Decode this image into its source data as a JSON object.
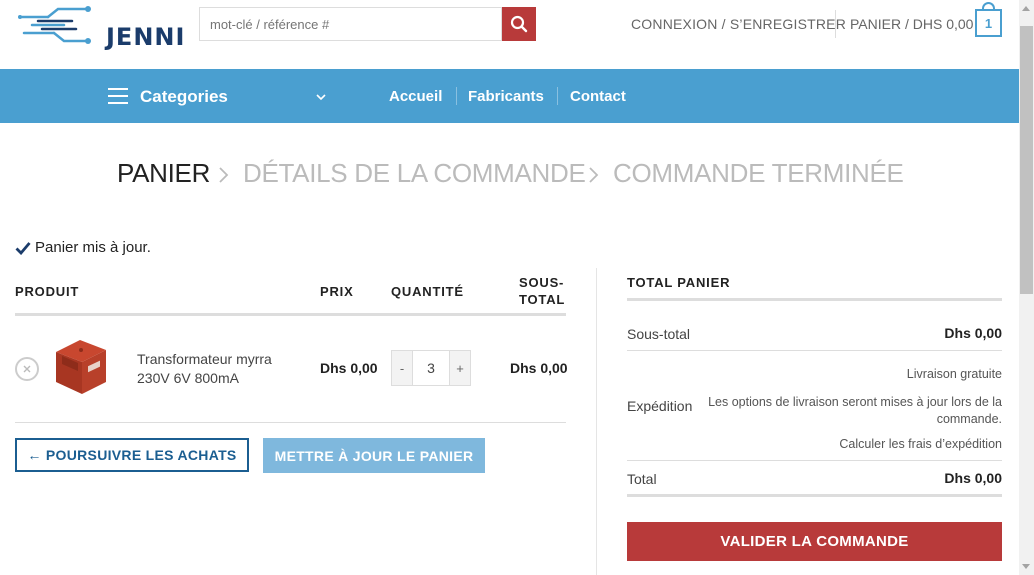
{
  "header": {
    "logo_text": "JENNI",
    "search_placeholder": "mot-clé / référence #",
    "login_label": "CONNEXION / S’ENREGISTRER",
    "cart_label": "PANIER / DHS 0,00",
    "cart_count": "1"
  },
  "nav": {
    "categories_label": "Categories",
    "links": [
      "Accueil",
      "Fabricants",
      "Contact"
    ]
  },
  "steps": {
    "step1": "PANIER",
    "step2": "DÉTAILS DE LA COMMANDE",
    "step3": "COMMANDE TERMINÉE"
  },
  "notice": "Panier mis à jour.",
  "cart_table": {
    "headers": {
      "product": "PRODUIT",
      "price": "PRIX",
      "quantity": "QUANTITÉ",
      "subtotal_line1": "SOUS-",
      "subtotal_line2": "TOTAL"
    },
    "items": [
      {
        "name_line1": "Transformateur myrra",
        "name_line2": "230V 6V 800mA",
        "price": "Dhs 0,00",
        "quantity": "3",
        "subtotal": "Dhs 0,00"
      }
    ],
    "qty_minus": "-",
    "qty_plus": "+",
    "continue_label": "← POURSUIVRE LES ACHATS",
    "update_label": "METTRE À JOUR LE PANIER"
  },
  "totals": {
    "title": "TOTAL PANIER",
    "subtotal_label": "Sous-total",
    "subtotal_value": "Dhs 0,00",
    "shipping_label": "Expédition",
    "shipping_free": "Livraison gratuite",
    "shipping_note_line1": "Les options de livraison seront mises à jour lors de la",
    "shipping_note_line2": "commande.",
    "shipping_calc": "Calculer les frais d’expédition",
    "total_label": "Total",
    "total_value": "Dhs 0,00",
    "checkout_label": "VALIDER LA COMMANDE"
  },
  "colors": {
    "brand_blue": "#4a9fd0",
    "brand_red": "#b83a3a",
    "navy": "#1b5e91"
  }
}
